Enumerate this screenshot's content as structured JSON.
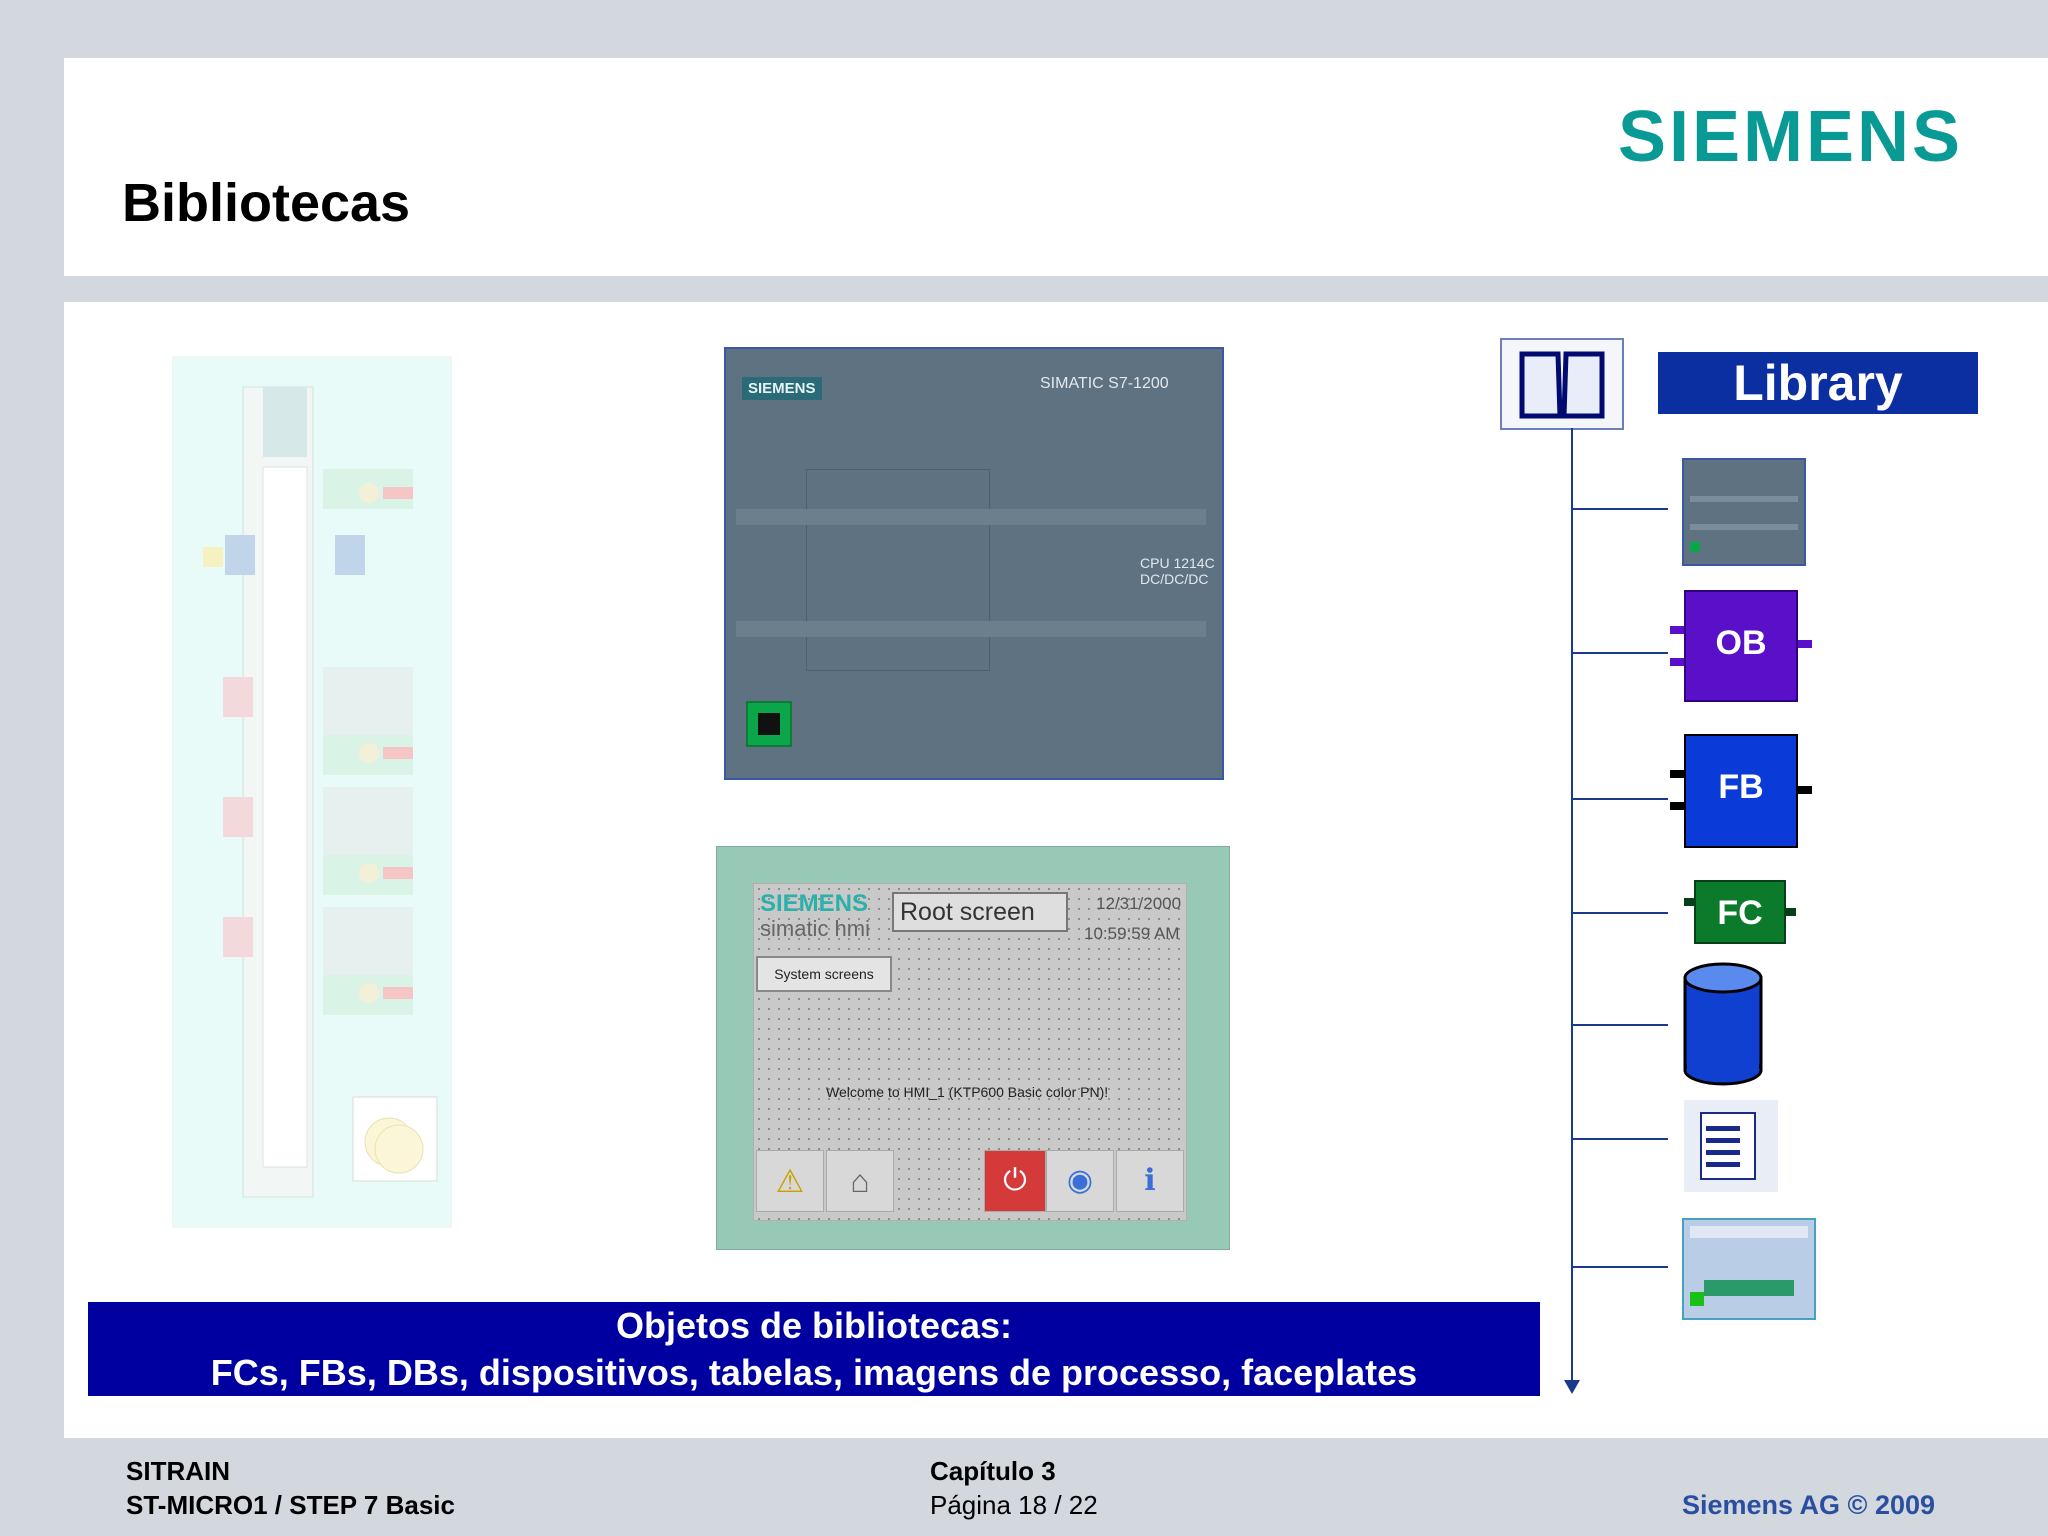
{
  "slide": {
    "title": "Bibliotecas",
    "logo": "SIEMENS"
  },
  "cpu_image": {
    "brand": "SIEMENS",
    "model": "SIMATIC S7-1200",
    "cpu_line1": "CPU 1214C",
    "cpu_line2": "DC/DC/DC"
  },
  "hmi_image": {
    "brand": "SIEMENS",
    "subtitle": "simatic hmi",
    "screen_title": "Root screen",
    "date": "12/31/2000",
    "time": "10:59:59 AM",
    "button": "System screens",
    "welcome": "Welcome to HMI_1 (KTP600 Basic color PN)!"
  },
  "library": {
    "label": "Library",
    "items": [
      {
        "icon": "cpu-device-icon"
      },
      {
        "label": "OB",
        "icon": "ob-block-icon",
        "color": "#5a10c8"
      },
      {
        "label": "FB",
        "icon": "fb-block-icon",
        "color": "#0a3ad8"
      },
      {
        "label": "FC",
        "icon": "fc-block-icon",
        "color": "#0b7a2a"
      },
      {
        "icon": "db-cylinder-icon",
        "color": "#1040d0"
      },
      {
        "icon": "tag-table-icon"
      },
      {
        "icon": "process-image-icon"
      }
    ]
  },
  "banner": {
    "line1": "Objetos de bibliotecas:",
    "line2": "FCs, FBs, DBs, dispositivos, tabelas, imagens de processo, faceplates"
  },
  "footer": {
    "org": "SITRAIN",
    "course": "ST-MICRO1 / STEP 7 Basic",
    "chapter": "Capítulo 3",
    "page": "Página 18 / 22",
    "copyright": "Siemens AG © 2009"
  },
  "colors": {
    "siemens_teal": "#0a9a96",
    "banner_blue": "#0000a0",
    "library_blue": "#0b2fa0",
    "footer_blue": "#2b4fa0"
  }
}
